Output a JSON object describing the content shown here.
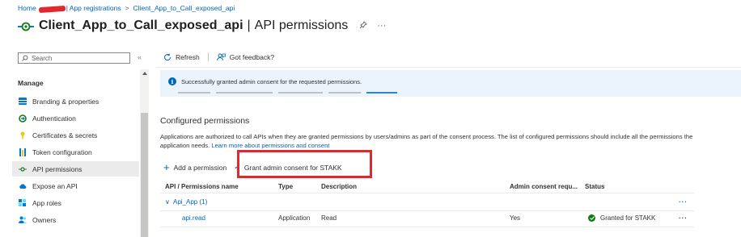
{
  "breadcrumb": {
    "home": "Home",
    "redacted_suffix": "| App registrations",
    "current": "Client_App_to_Call_exposed_api",
    "separator": ">"
  },
  "title": {
    "app_name": "Client_App_to_Call_exposed_api",
    "separator": "|",
    "page": "API permissions",
    "more_glyph": "···"
  },
  "sidebar": {
    "search_placeholder": "Search",
    "collapse_glyph": "«",
    "section": "Manage",
    "items": [
      {
        "label": "Branding & properties",
        "icon": "branding-icon"
      },
      {
        "label": "Authentication",
        "icon": "authentication-icon"
      },
      {
        "label": "Certificates & secrets",
        "icon": "key-icon"
      },
      {
        "label": "Token configuration",
        "icon": "token-icon"
      },
      {
        "label": "API permissions",
        "icon": "api-permissions-icon",
        "active": true
      },
      {
        "label": "Expose an API",
        "icon": "cloud-icon"
      },
      {
        "label": "App roles",
        "icon": "app-roles-icon"
      },
      {
        "label": "Owners",
        "icon": "owners-icon"
      }
    ]
  },
  "toolbar": {
    "refresh": "Refresh",
    "feedback": "Got feedback?"
  },
  "banner": {
    "message": "Successfully granted admin consent for the requested permissions."
  },
  "configured": {
    "title": "Configured permissions",
    "description": "Applications are authorized to call APIs when they are granted permissions by users/admins as part of the consent process. The list of configured permissions should include all the permissions the application needs.",
    "learn_more": "Learn more about permissions and consent"
  },
  "actions": {
    "add_permission": "Add a permission",
    "grant_consent": "Grant admin consent for STAKK"
  },
  "table": {
    "headers": [
      "API / Permissions name",
      "Type",
      "Description",
      "Admin consent requ...",
      "Status"
    ],
    "group": {
      "name": "Api_App (1)",
      "chevron": "∨"
    },
    "rows": [
      {
        "name": "api.read",
        "type": "Application",
        "description": "Read",
        "admin_consent": "Yes",
        "status": "Granted for STAKK"
      }
    ],
    "more_glyph": "···"
  },
  "colors": {
    "accent": "#0066b8",
    "highlight_box": "#e0282e",
    "success": "#107c10",
    "banner_bg": "#ebf3fc"
  }
}
